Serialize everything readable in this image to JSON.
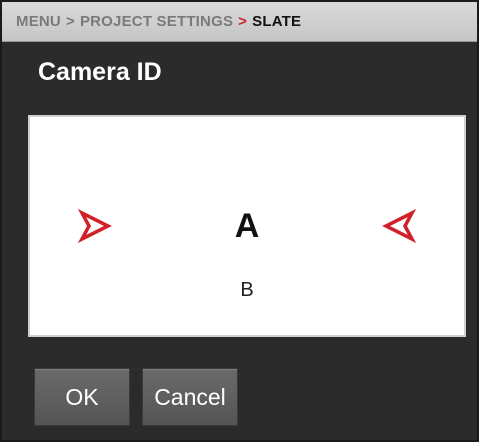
{
  "breadcrumb": {
    "items": [
      "MENU",
      "PROJECT SETTINGS",
      "SLATE"
    ],
    "separator": ">"
  },
  "dialog": {
    "title": "Camera ID",
    "selected_value": "A",
    "next_value": "B",
    "left_arrow_icon": "chevron-right-outline-icon",
    "right_arrow_icon": "chevron-left-outline-icon"
  },
  "buttons": {
    "ok_label": "OK",
    "cancel_label": "Cancel"
  },
  "colors": {
    "accent_red": "#d0202a",
    "background": "#2b2b2b",
    "header": "#cfcfcf",
    "button": "#5f5f5f"
  }
}
